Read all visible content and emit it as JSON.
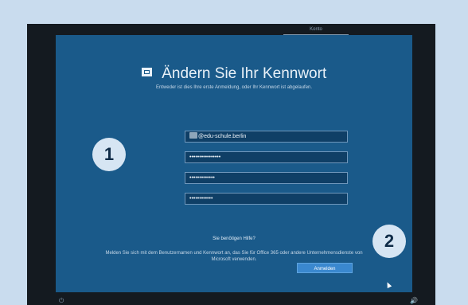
{
  "window": {
    "tab_label": "Konto"
  },
  "form": {
    "title": "Ändern Sie Ihr Kennwort",
    "subtitle": "Entweder ist dies Ihre erste Anmeldung, oder Ihr Kennwort ist abgelaufen.",
    "username_suffix": "@edu-schule.berlin",
    "old_password": "••••••••••••••••",
    "new_password": "•••••••••••••",
    "confirm_password": "••••••••••••",
    "help_link": "Sie benötigen Hilfe?",
    "info_text": "Melden Sie sich mit dem Benutzernamen und Kennwort an, das Sie für Office 365 oder andere Unternehmensdienste von Microsoft verwenden.",
    "signin_label": "Anmelden"
  },
  "callouts": {
    "marker_1": "1",
    "marker_2": "2"
  },
  "taskbar": {
    "power_icon": "⏻",
    "volume_icon": "🔊"
  },
  "colors": {
    "page_background": "#c9dcee",
    "panel_background": "#1a5a8a",
    "button_accent": "#3a88cf"
  }
}
